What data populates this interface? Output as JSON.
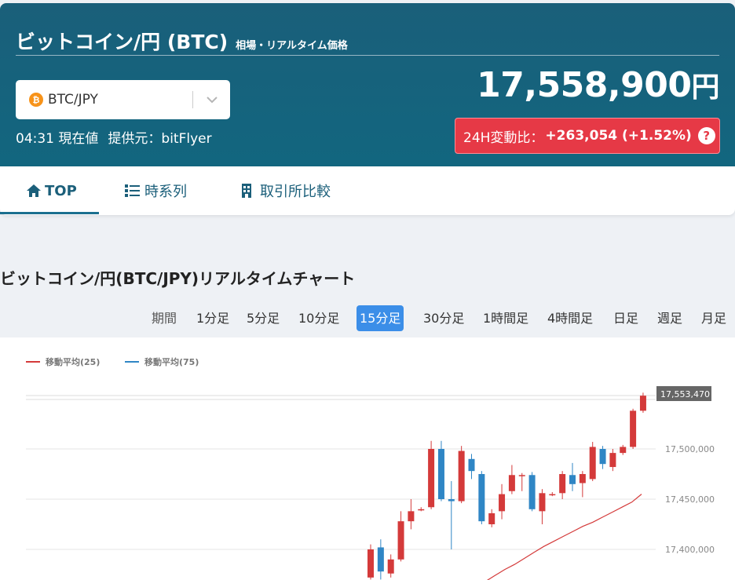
{
  "header": {
    "title": "ビットコイン/円 (BTC)",
    "subtitle": "相場・リアルタイム価格",
    "pair_select": {
      "value": "BTC/JPY",
      "coin_icon": "bitcoin-icon"
    },
    "time": "04:31 現在値",
    "provider": "提供元：bitFlyer",
    "price": "17,558,900",
    "price_unit": "円",
    "change_label": "24H変動比：",
    "change_value": "+263,054 (+1.52%)",
    "help_glyph": "?",
    "change_color": "#e63946"
  },
  "tabs": [
    {
      "label": "TOP",
      "icon": "home-icon",
      "active": true
    },
    {
      "label": "時系列",
      "icon": "list-icon",
      "active": false
    },
    {
      "label": "取引所比較",
      "icon": "building-icon",
      "active": false
    }
  ],
  "chart_section": {
    "title": "ビットコイン/円(BTC/JPY)リアルタイムチャート",
    "period_label": "期間",
    "periods": [
      "1分足",
      "5分足",
      "10分足",
      "15分足",
      "30分足",
      "1時間足",
      "4時間足",
      "日足",
      "週足",
      "月足"
    ],
    "active_period": "15分足"
  },
  "chart_data": {
    "type": "candlestick",
    "legend": [
      {
        "name": "移動平均(25)",
        "color": "#d43a3a"
      },
      {
        "name": "移動平均(75)",
        "color": "#2f86c5"
      }
    ],
    "y_ticks": [
      17400000,
      17450000,
      17500000
    ],
    "y_tick_labels": [
      "17,400,000",
      "17,450,000",
      "17,500,000"
    ],
    "current_price_label": "17,553,470",
    "current_price": 17553470,
    "ylim": [
      17370000,
      17560000
    ],
    "up_color": "#d43a3a",
    "down_color": "#2f86c5",
    "candles": [
      {
        "o": 17372000,
        "c": 17400000,
        "h": 17405000,
        "l": 17370000
      },
      {
        "o": 17402000,
        "c": 17378000,
        "h": 17410000,
        "l": 17370000
      },
      {
        "o": 17376000,
        "c": 17390000,
        "h": 17395000,
        "l": 17372000
      },
      {
        "o": 17390000,
        "c": 17428000,
        "h": 17438000,
        "l": 17388000
      },
      {
        "o": 17428000,
        "c": 17438000,
        "h": 17450000,
        "l": 17420000
      },
      {
        "o": 17440000,
        "c": 17440000,
        "h": 17442000,
        "l": 17438000
      },
      {
        "o": 17442000,
        "c": 17500000,
        "h": 17508000,
        "l": 17440000
      },
      {
        "o": 17500000,
        "c": 17450000,
        "h": 17508000,
        "l": 17448000
      },
      {
        "o": 17450000,
        "c": 17448000,
        "h": 17468000,
        "l": 17400000
      },
      {
        "o": 17448000,
        "c": 17498000,
        "h": 17503000,
        "l": 17446000
      },
      {
        "o": 17490000,
        "c": 17478000,
        "h": 17495000,
        "l": 17470000
      },
      {
        "o": 17475000,
        "c": 17428000,
        "h": 17478000,
        "l": 17425000
      },
      {
        "o": 17425000,
        "c": 17436000,
        "h": 17440000,
        "l": 17422000
      },
      {
        "o": 17438000,
        "c": 17455000,
        "h": 17465000,
        "l": 17430000
      },
      {
        "o": 17458000,
        "c": 17474000,
        "h": 17484000,
        "l": 17455000
      },
      {
        "o": 17473000,
        "c": 17474000,
        "h": 17476000,
        "l": 17458000
      },
      {
        "o": 17474000,
        "c": 17440000,
        "h": 17477000,
        "l": 17438000
      },
      {
        "o": 17438000,
        "c": 17456000,
        "h": 17460000,
        "l": 17425000
      },
      {
        "o": 17455000,
        "c": 17455000,
        "h": 17457000,
        "l": 17453000
      },
      {
        "o": 17456000,
        "c": 17475000,
        "h": 17478000,
        "l": 17450000
      },
      {
        "o": 17474000,
        "c": 17465000,
        "h": 17486000,
        "l": 17458000
      },
      {
        "o": 17466000,
        "c": 17475000,
        "h": 17478000,
        "l": 17452000
      },
      {
        "o": 17470000,
        "c": 17502000,
        "h": 17507000,
        "l": 17468000
      },
      {
        "o": 17500000,
        "c": 17485000,
        "h": 17503000,
        "l": 17480000
      },
      {
        "o": 17482000,
        "c": 17496000,
        "h": 17500000,
        "l": 17478000
      },
      {
        "o": 17496000,
        "c": 17502000,
        "h": 17504000,
        "l": 17494000
      },
      {
        "o": 17502000,
        "c": 17538000,
        "h": 17540000,
        "l": 17500000
      },
      {
        "o": 17538000,
        "c": 17553000,
        "h": 17556000,
        "l": 17536000
      }
    ],
    "ma25": [
      17355000,
      17362000,
      17368000,
      17374000,
      17380000,
      17385000,
      17391000,
      17397000,
      17403000,
      17408000,
      17413000,
      17418000,
      17423000,
      17427000,
      17432000,
      17437000,
      17442000,
      17447000,
      17455000
    ]
  }
}
